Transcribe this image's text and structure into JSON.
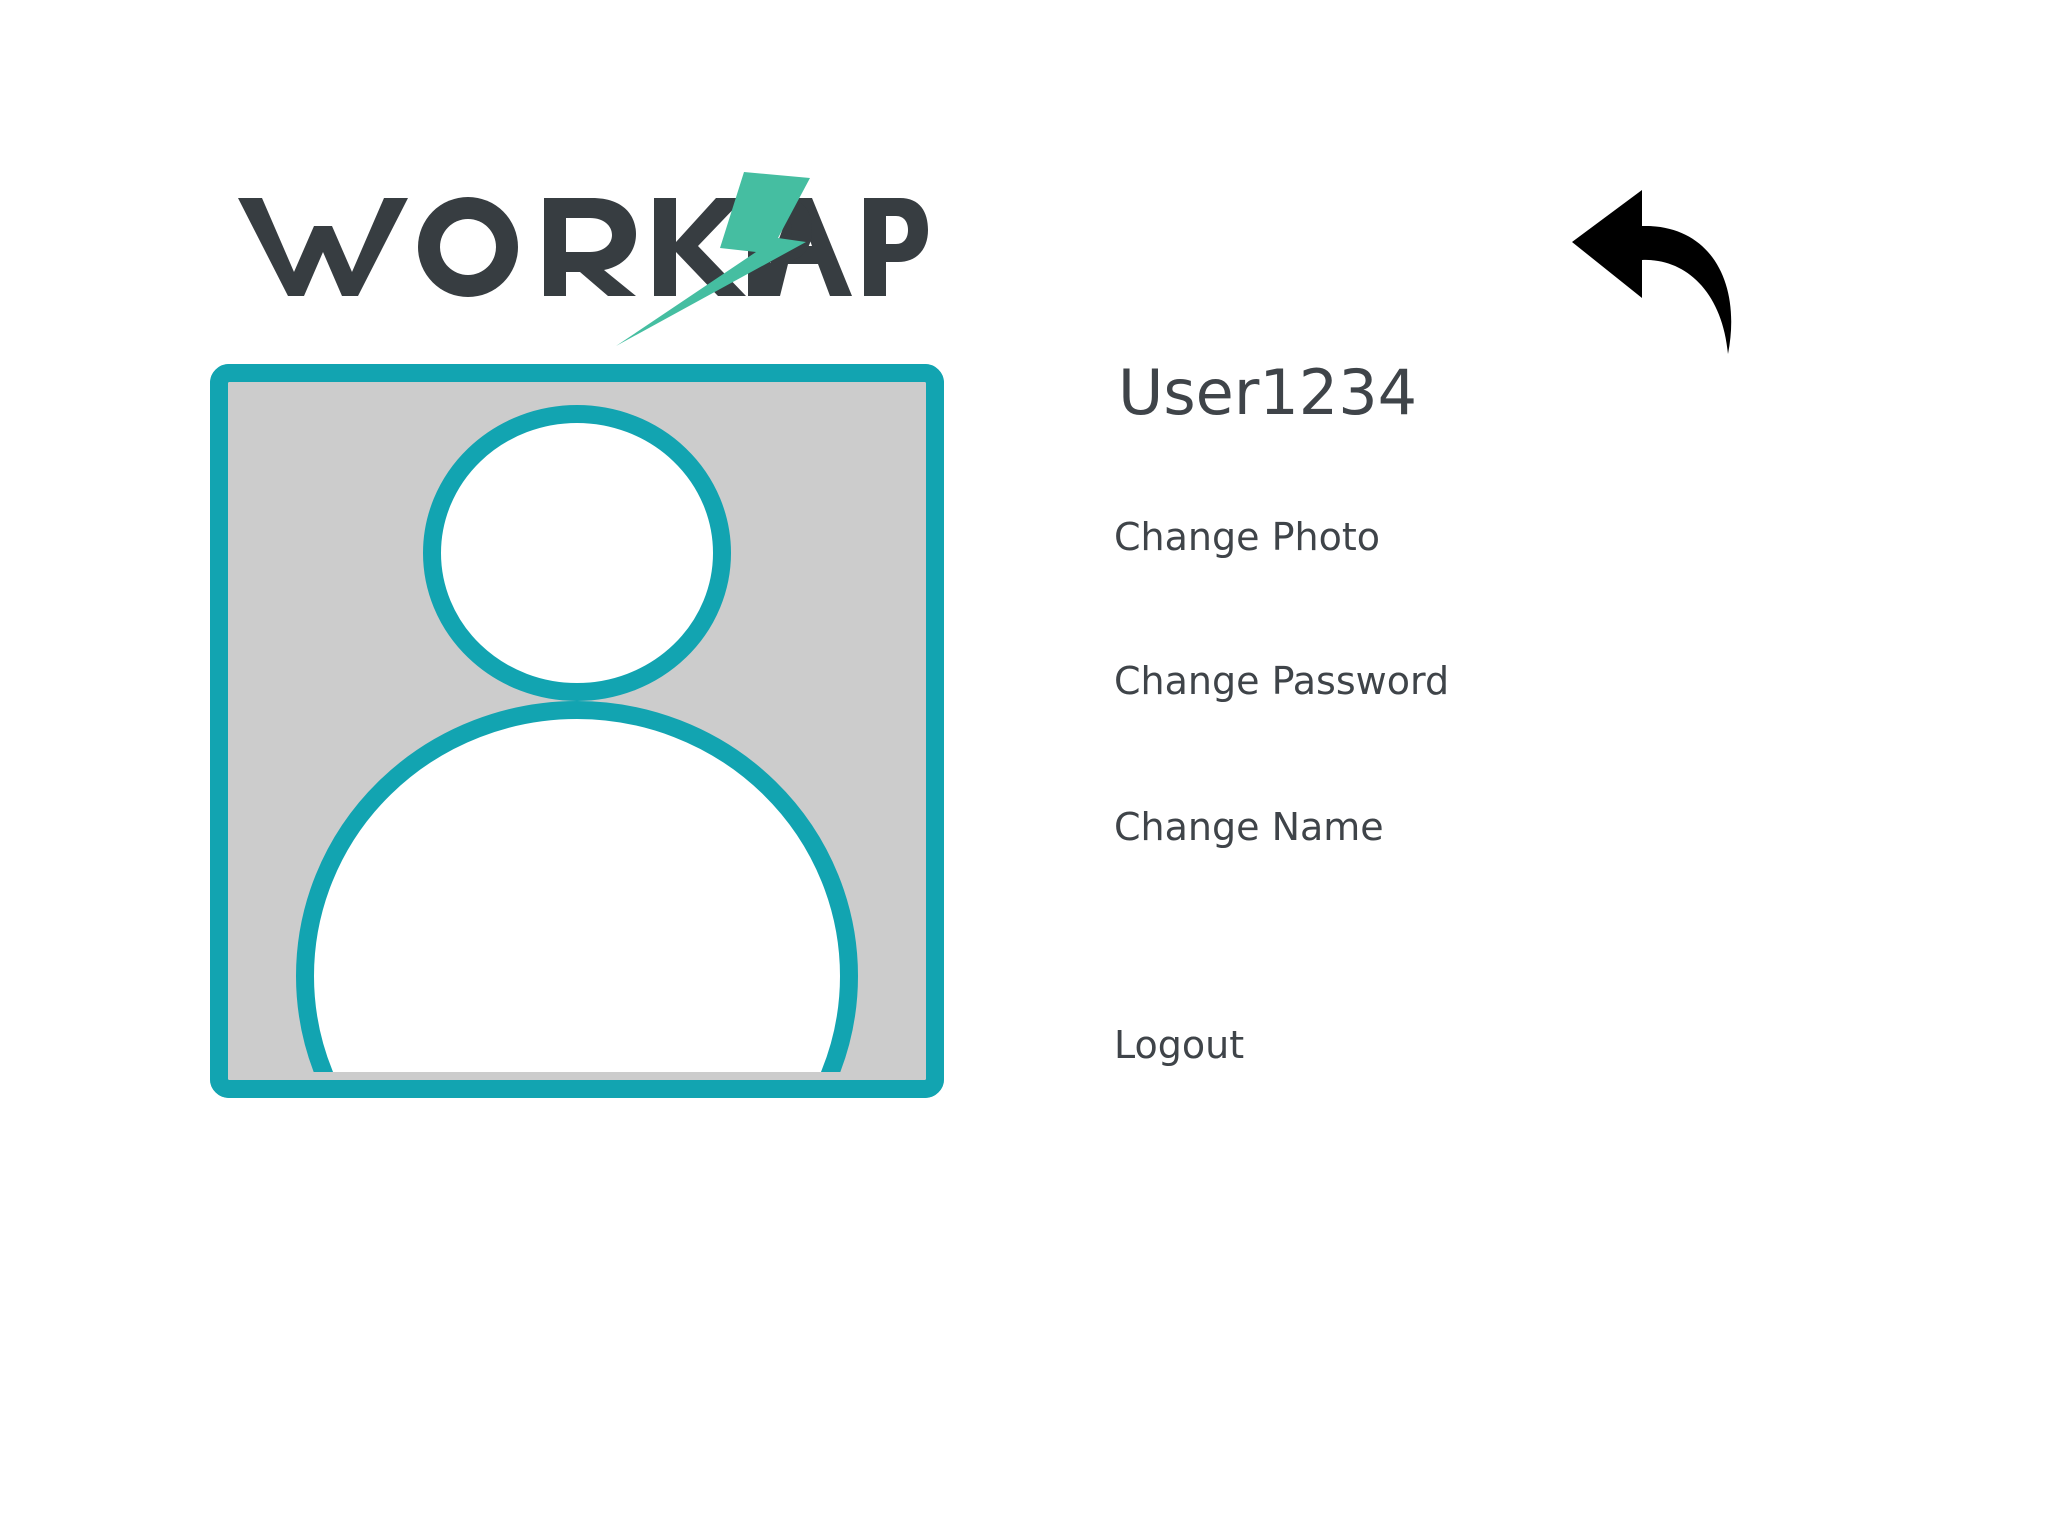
{
  "brand": {
    "logo_text": "WORKAPP",
    "logo_text_color": "#373d41",
    "bolt_color": "#45bea1"
  },
  "colors": {
    "accent": "#12a4b1",
    "avatar_background": "#cccccc",
    "text": "#3f4449"
  },
  "header": {
    "back_icon": "undo-arrow-icon"
  },
  "profile": {
    "username": "User1234",
    "avatar_icon": "user-silhouette-icon"
  },
  "menu": {
    "change_photo": "Change Photo",
    "change_password": "Change Password",
    "change_name": "Change Name",
    "logout": "Logout"
  }
}
